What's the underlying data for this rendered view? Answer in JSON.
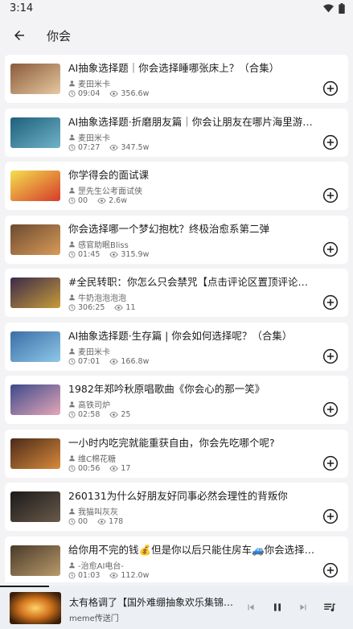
{
  "status": {
    "time": "3:14"
  },
  "header": {
    "title": "你会"
  },
  "videos": [
    {
      "title": "AI抽象选择题｜你会选择睡哪张床上？（合集）",
      "author": "麦田米卡",
      "duration": "09:04",
      "views": "356.6w",
      "thumb_colors": [
        "#8a5a3a",
        "#e6c9a0"
      ]
    },
    {
      "title": "AI抽象选择题·折磨朋友篇｜你会让朋友在哪片海里游泳？（合集）",
      "author": "麦田米卡",
      "duration": "07:27",
      "views": "347.5w",
      "thumb_colors": [
        "#1f5f7a",
        "#6fb3c8"
      ]
    },
    {
      "title": "你学得会的面试课",
      "author": "罡先生公考面试侠",
      "duration": "00",
      "views": "2.6w",
      "thumb_colors": [
        "#f4e04d",
        "#d63b2b"
      ]
    },
    {
      "title": "你会选择哪一个梦幻抱枕？终极治愈系第二弹",
      "author": "感官助眠Bliss",
      "duration": "01:45",
      "views": "315.9w",
      "thumb_colors": [
        "#6b4a2f",
        "#d99b5a"
      ]
    },
    {
      "title": "#全民转职：你怎么只会禁咒【点击评论区置顶评论免费观看全…",
      "author": "牛奶泡泡泡泡",
      "duration": "306:25",
      "views": "11",
      "thumb_colors": [
        "#3b2a4a",
        "#c89b3a"
      ]
    },
    {
      "title": "AI抽象选择题·生存篇 | 你会如何选择呢？（合集）",
      "author": "麦田米卡",
      "duration": "07:01",
      "views": "166.8w",
      "thumb_colors": [
        "#3a6ea5",
        "#8ec7e8"
      ]
    },
    {
      "title": "1982年郑吟秋原唱歌曲《你会心的那一笑》",
      "author": "高铁司炉",
      "duration": "02:58",
      "views": "25",
      "thumb_colors": [
        "#3c4a8a",
        "#e6a6b8"
      ]
    },
    {
      "title": "一小时内吃完就能重获自由，你会先吃哪个呢?",
      "author": "维C棉花糖",
      "duration": "00:56",
      "views": "17",
      "thumb_colors": [
        "#4a2a1a",
        "#d98a3a"
      ]
    },
    {
      "title": "260131为什么好朋友好同事必然会理性的背叛你",
      "author": "我猫叫灰灰",
      "duration": "00",
      "views": "178",
      "thumb_colors": [
        "#1a1a1a",
        "#6a5a4a"
      ]
    },
    {
      "title": "给你用不完的钱💰但是你以后只能住房车🚙你会选择哪个（一）",
      "author": "-治愈AI电台-",
      "duration": "01:03",
      "views": "112.0w",
      "thumb_colors": [
        "#4a3a2a",
        "#b89a6a"
      ]
    }
  ],
  "player": {
    "title": "太有格调了【国外难绷抽象欢乐集锦#1…",
    "artist": "meme传送门",
    "progress": 0.14
  },
  "icons": {
    "back": "arrow-left-icon",
    "user": "user-icon",
    "clock": "clock-icon",
    "views": "eye-icon",
    "add": "add-circle-icon",
    "prev": "skip-previous-icon",
    "pause": "pause-icon",
    "next": "skip-next-icon",
    "playlist": "queue-music-icon"
  }
}
